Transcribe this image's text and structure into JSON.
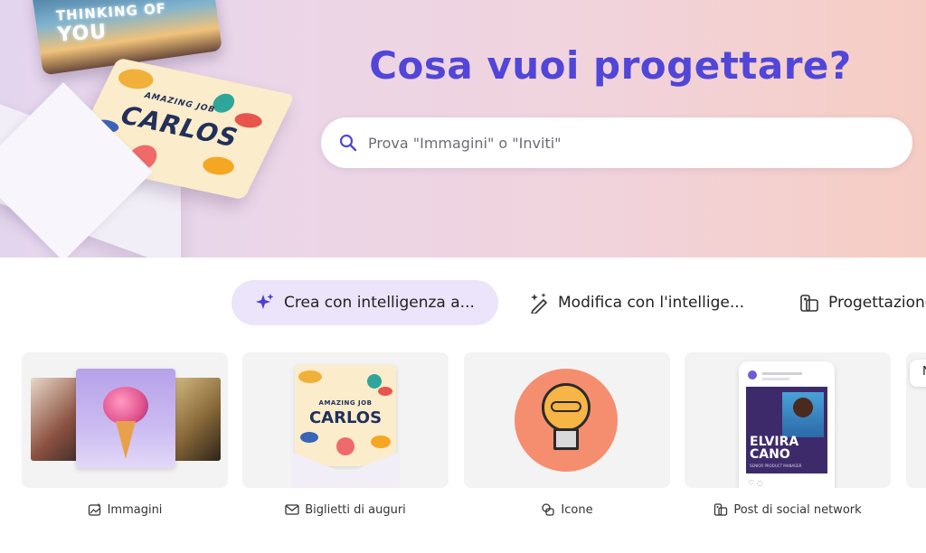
{
  "hero": {
    "title": "Cosa vuoi progettare?",
    "search_placeholder": "Prova \"Immagini\" o \"Inviti\"",
    "card_top_text_1": "THINKING OF",
    "card_top_text_2": "YOU",
    "card_bottom_text_1": "AMAZING JOB",
    "card_bottom_text_2": "CARLOS"
  },
  "tabs": [
    {
      "label": "Crea con intelligenza a...",
      "icon": "sparkle-icon",
      "active": true
    },
    {
      "label": "Modifica con l'intellige...",
      "icon": "magic-pen-icon",
      "active": false
    },
    {
      "label": "Progettazione",
      "icon": "design-icon",
      "active": false
    }
  ],
  "cards": [
    {
      "label": "Immagini",
      "icon": "image-ai-icon"
    },
    {
      "label": "Biglietti di auguri",
      "icon": "mail-icon",
      "card_text_1": "AMAZING JOB",
      "card_text_2": "CARLOS"
    },
    {
      "label": "Icone",
      "icon": "icon-shapes-icon"
    },
    {
      "label": "Post di social network",
      "icon": "social-post-icon",
      "post_name_1": "ELVIRA",
      "post_name_2": "CANO",
      "post_subtitle": "SENIOR PRODUCT MANAGER"
    },
    {
      "label": "",
      "icon": "",
      "partial_text": "N"
    }
  ],
  "colors": {
    "accent": "#5146d8",
    "active_tab_bg": "#ebe4fa",
    "card_bg": "#f3f3f4"
  }
}
